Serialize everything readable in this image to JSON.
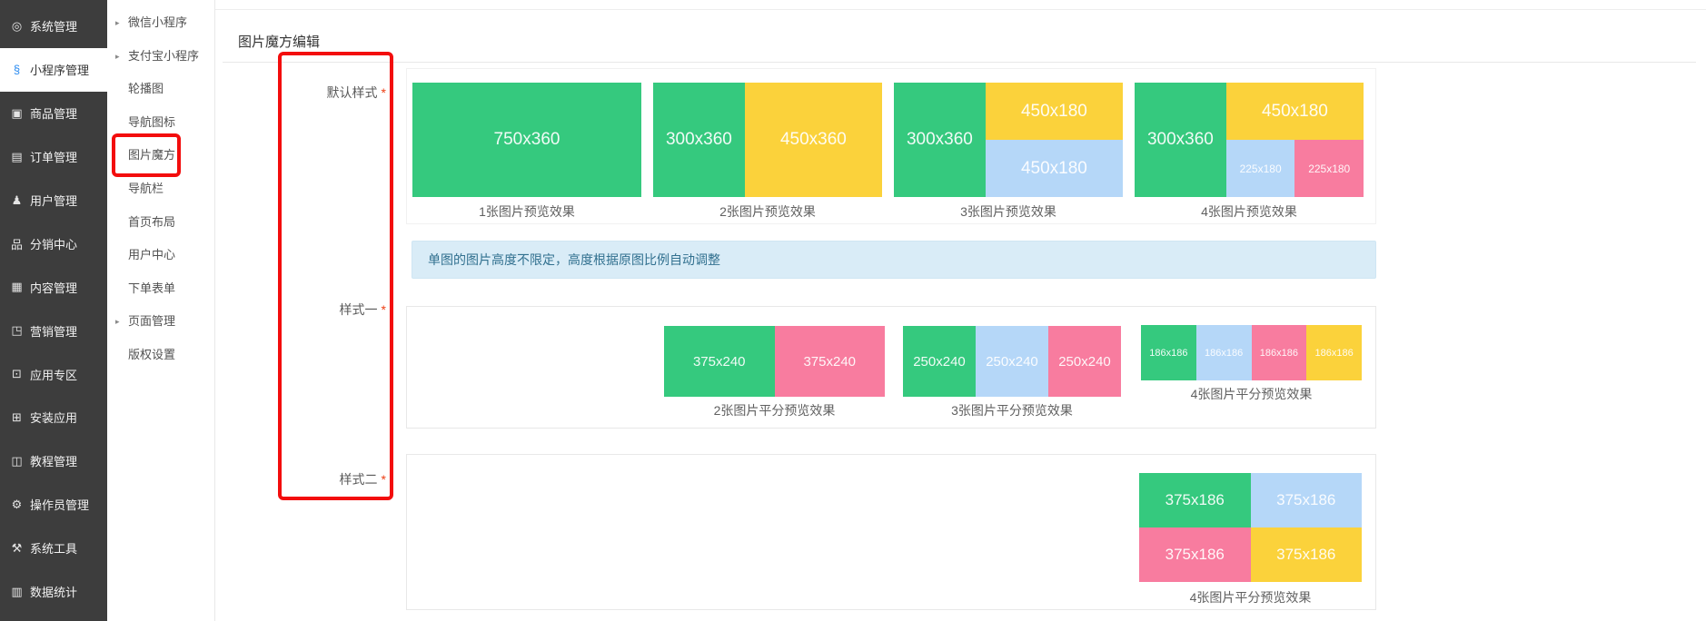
{
  "colors": {
    "green": "#35c97e",
    "yellow": "#fbd23b",
    "blue": "#b5d7f8",
    "pink": "#f87c9f",
    "annotation_red": "#f30d0d",
    "active_icon_blue": "#2d8cf0",
    "info_bg": "#d9ecf7",
    "info_text": "#31708f",
    "sidebar_bg": "#3d3d3d"
  },
  "sidebar": {
    "items": [
      {
        "label": "系统管理",
        "icon": "settings-gear-icon",
        "glyph": "◎",
        "active": false
      },
      {
        "label": "小程序管理",
        "icon": "miniprogram-link-icon",
        "glyph": "§",
        "active": true
      },
      {
        "label": "商品管理",
        "icon": "goods-bag-icon",
        "glyph": "▣",
        "active": false
      },
      {
        "label": "订单管理",
        "icon": "order-list-icon",
        "glyph": "▤",
        "active": false
      },
      {
        "label": "用户管理",
        "icon": "user-icon",
        "glyph": "♟",
        "active": false
      },
      {
        "label": "分销中心",
        "icon": "distribution-sitemap-icon",
        "glyph": "品",
        "active": false
      },
      {
        "label": "内容管理",
        "icon": "content-doc-icon",
        "glyph": "▦",
        "active": false
      },
      {
        "label": "营销管理",
        "icon": "marketing-icon",
        "glyph": "◳",
        "active": false
      },
      {
        "label": "应用专区",
        "icon": "app-zone-icon",
        "glyph": "⊡",
        "active": false
      },
      {
        "label": "安装应用",
        "icon": "install-grid-icon",
        "glyph": "⊞",
        "active": false
      },
      {
        "label": "教程管理",
        "icon": "tutorial-book-icon",
        "glyph": "◫",
        "active": false
      },
      {
        "label": "操作员管理",
        "icon": "operator-gear-icon",
        "glyph": "⚙",
        "active": false
      },
      {
        "label": "系统工具",
        "icon": "system-tools-icon",
        "glyph": "⚒",
        "active": false
      },
      {
        "label": "数据统计",
        "icon": "stats-chart-icon",
        "glyph": "▥",
        "active": false
      }
    ]
  },
  "submenu": {
    "items": [
      {
        "label": "微信小程序",
        "expandable": true,
        "highlighted": false
      },
      {
        "label": "支付宝小程序",
        "expandable": true,
        "highlighted": false
      },
      {
        "label": "轮播图",
        "expandable": false,
        "highlighted": false
      },
      {
        "label": "导航图标",
        "expandable": false,
        "highlighted": false
      },
      {
        "label": "图片魔方",
        "expandable": false,
        "highlighted": true
      },
      {
        "label": "导航栏",
        "expandable": false,
        "highlighted": false
      },
      {
        "label": "首页布局",
        "expandable": false,
        "highlighted": false
      },
      {
        "label": "用户中心",
        "expandable": false,
        "highlighted": false
      },
      {
        "label": "下单表单",
        "expandable": false,
        "highlighted": false
      },
      {
        "label": "页面管理",
        "expandable": true,
        "highlighted": false
      },
      {
        "label": "版权设置",
        "expandable": false,
        "highlighted": false
      }
    ]
  },
  "main": {
    "title": "图片魔方编辑",
    "required_mark": "*",
    "info_banner": "单图的图片高度不限定，高度根据原图比例自动调整",
    "rows": [
      {
        "label": "默认样式",
        "groups": [
          {
            "caption": "1张图片预览效果",
            "layout": "single",
            "blocks": [
              {
                "label": "750x360",
                "color": "green"
              }
            ]
          },
          {
            "caption": "2张图片预览效果",
            "layout": "split-lr",
            "blocks": [
              {
                "label": "300x360",
                "color": "green"
              },
              {
                "label": "450x360",
                "color": "yellow"
              }
            ]
          },
          {
            "caption": "3张图片预览效果",
            "layout": "left-plus-stack",
            "blocks": [
              {
                "label": "300x360",
                "color": "green"
              },
              {
                "label": "450x180",
                "color": "yellow"
              },
              {
                "label": "450x180",
                "color": "blue"
              }
            ]
          },
          {
            "caption": "4张图片预览效果",
            "layout": "left-plus-stack-split",
            "blocks": [
              {
                "label": "300x360",
                "color": "green"
              },
              {
                "label": "450x180",
                "color": "yellow"
              },
              {
                "label": "225x180",
                "color": "blue"
              },
              {
                "label": "225x180",
                "color": "pink"
              }
            ]
          }
        ]
      },
      {
        "label": "样式一",
        "groups": [
          {
            "caption": "2张图片平分预览效果",
            "small": false,
            "blocks": [
              {
                "label": "375x240",
                "color": "green"
              },
              {
                "label": "375x240",
                "color": "pink"
              }
            ]
          },
          {
            "caption": "3张图片平分预览效果",
            "small": false,
            "blocks": [
              {
                "label": "250x240",
                "color": "green"
              },
              {
                "label": "250x240",
                "color": "blue"
              },
              {
                "label": "250x240",
                "color": "pink"
              }
            ]
          },
          {
            "caption": "4张图片平分预览效果",
            "small": true,
            "blocks": [
              {
                "label": "186x186",
                "color": "green"
              },
              {
                "label": "186x186",
                "color": "blue"
              },
              {
                "label": "186x186",
                "color": "pink"
              },
              {
                "label": "186x186",
                "color": "yellow"
              }
            ]
          }
        ]
      },
      {
        "label": "样式二",
        "groups": [
          {
            "caption": "4张图片平分预览效果",
            "grid": [
              [
                {
                  "label": "375x186",
                  "color": "green"
                },
                {
                  "label": "375x186",
                  "color": "blue"
                }
              ],
              [
                {
                  "label": "375x186",
                  "color": "pink"
                },
                {
                  "label": "375x186",
                  "color": "yellow"
                }
              ]
            ]
          }
        ]
      }
    ]
  }
}
